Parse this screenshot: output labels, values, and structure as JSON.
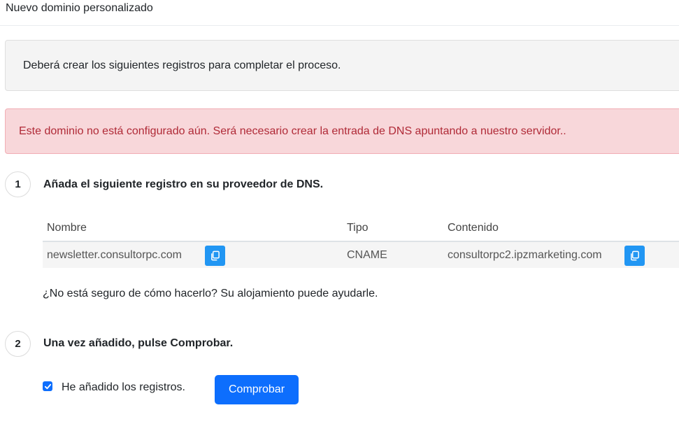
{
  "header": {
    "title": "Nuevo dominio personalizado"
  },
  "info": {
    "text": "Deberá crear los siguientes registros para completar el proceso."
  },
  "alert": {
    "text": "Este dominio no está configurado aún. Será necesario crear la entrada de DNS apuntando a nuestro servidor.."
  },
  "steps": [
    {
      "number": "1",
      "title": "Añada el siguiente registro en su proveedor de DNS."
    },
    {
      "number": "2",
      "title": "Una vez añadido, pulse Comprobar."
    }
  ],
  "dns_table": {
    "columns": [
      "Nombre",
      "Tipo",
      "Contenido"
    ],
    "rows": [
      {
        "name": "newsletter.consultorpc.com",
        "type": "CNAME",
        "content": "consultorpc2.ipzmarketing.com"
      }
    ]
  },
  "help": {
    "text": "¿No está seguro de cómo hacerlo? Su alojamiento puede ayudarle."
  },
  "confirm": {
    "checkbox_label": "He añadido los registros.",
    "checked": true,
    "button_label": "Comprobar"
  },
  "colors": {
    "primary": "#0d6efd",
    "copy": "#2196f3",
    "alert_text": "#b02a37",
    "alert_bg": "#f8d7da"
  },
  "icons": {
    "copy": "copy-icon",
    "check": "checkmark-icon"
  }
}
